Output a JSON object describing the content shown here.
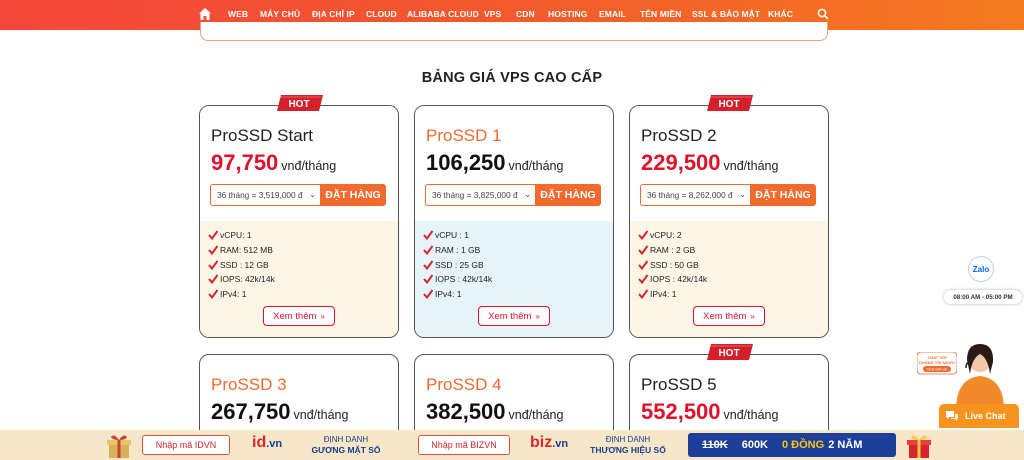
{
  "nav": {
    "items": [
      "WEB",
      "MÁY CHỦ",
      "ĐỊA CHỈ IP",
      "CLOUD",
      "ALIBABA CLOUD",
      "VPS",
      "CDN",
      "HOSTING",
      "EMAIL",
      "TÊN MIỀN",
      "SSL & BẢO MẬT",
      "KHÁC"
    ]
  },
  "section_title": "BẢNG GIÁ VPS CAO CẤP",
  "hot_label": "HOT",
  "unit": "vnđ/tháng",
  "order_label": "ĐẶT HÀNG",
  "more_label": "Xem thêm",
  "plans": [
    {
      "name": "ProSSD Start",
      "price": "97,750",
      "option": "36 tháng = 3,519,000 đ",
      "specs": [
        "vCPU: 1",
        "RAM: 512 MB",
        "SSD : 12 GB",
        "IOPS: 42k/14k",
        "IPv4: 1"
      ]
    },
    {
      "name": "ProSSD 1",
      "price": "106,250",
      "option": "36 tháng = 3,825,000 đ",
      "specs": [
        "vCPU : 1",
        "RAM : 1 GB",
        "SSD : 25 GB",
        "IOPS : 42k/14k",
        "IPv4: 1"
      ]
    },
    {
      "name": "ProSSD 2",
      "price": "229,500",
      "option": "36 tháng = 8,262,000 đ",
      "specs": [
        "vCPU: 2",
        "RAM : 2 GB",
        "SSD : 50 GB",
        "IOPS : 42k/14k",
        "IPv4: 1"
      ]
    },
    {
      "name": "ProSSD 3",
      "price": "267,750"
    },
    {
      "name": "ProSSD 4",
      "price": "382,500"
    },
    {
      "name": "ProSSD 5",
      "price": "552,500"
    }
  ],
  "zalo": {
    "label": "Zalo",
    "hours": "08:00 AM - 05:00 PM"
  },
  "chat_bubble": {
    "line1": "CHAT VỚI",
    "line2": "CHÚNG TÔI NGAY!",
    "line3": "Chat with us!"
  },
  "livechat": "Live Chat",
  "promo": {
    "code1": "Nhập mã IDVN",
    "logo1": "id",
    "logo1_suffix": ".vn",
    "tag1_l1": "ĐỊNH DANH",
    "tag1_l2": "GƯƠNG MẶT SỐ",
    "code2": "Nhập mã BIZVN",
    "logo2": "biz",
    "logo2_suffix": ".vn",
    "tag2_l1": "ĐỊNH DANH",
    "tag2_l2": "THƯƠNG HIỆU SỐ",
    "old_price": "110K",
    "new_price": "600K",
    "zero": "0 ĐỒNG",
    "years": "2 NĂM"
  },
  "colors": {
    "brand_orange": "#f26a2e",
    "price_red": "#e0112b",
    "nav_gradient_start": "#f4463a",
    "nav_gradient_end": "#f47a1f",
    "deal_blue": "#1e3f99"
  }
}
